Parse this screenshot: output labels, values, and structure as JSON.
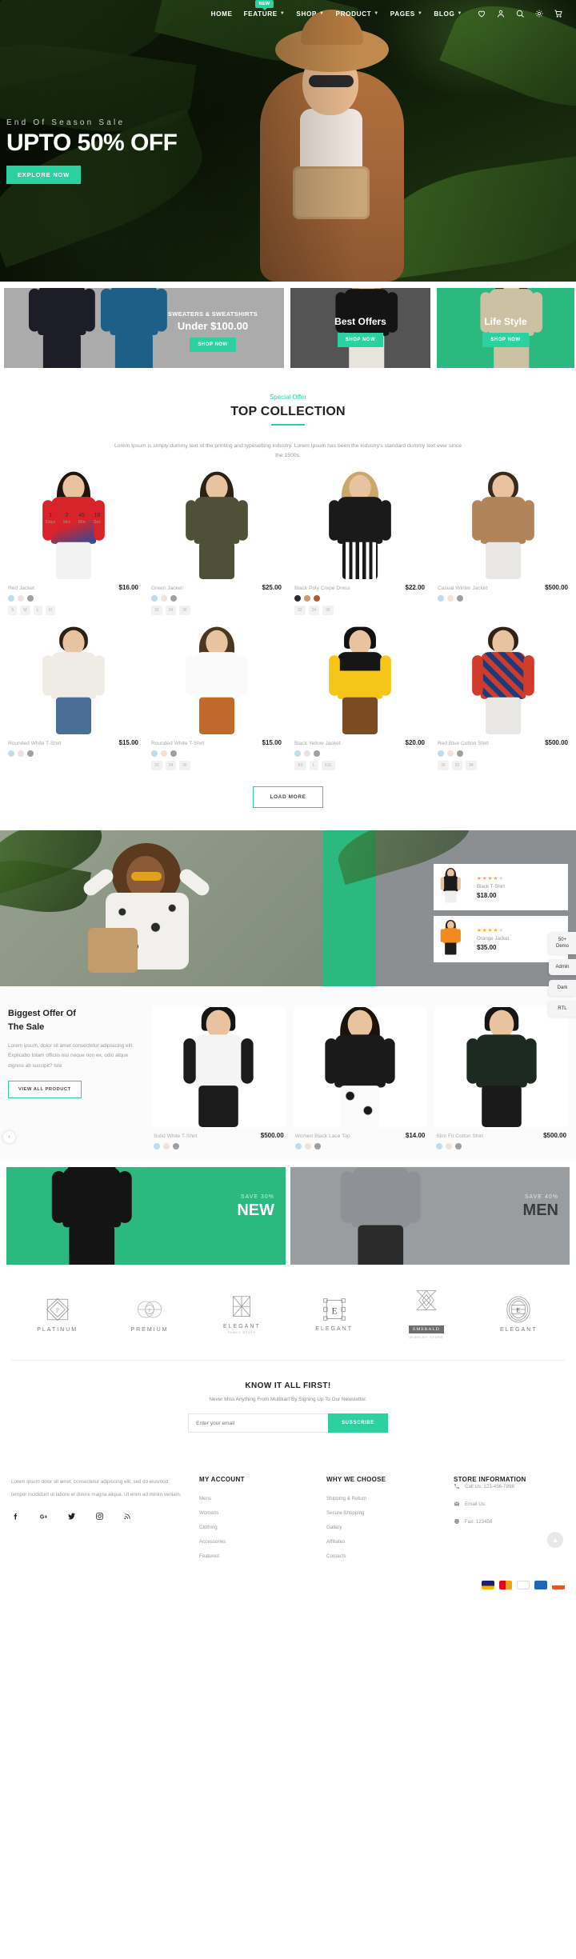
{
  "nav": {
    "items": [
      {
        "label": "HOME",
        "caret": false,
        "badge": null
      },
      {
        "label": "FEATURE",
        "caret": true,
        "badge": "NEW"
      },
      {
        "label": "SHOP",
        "caret": true,
        "badge": null
      },
      {
        "label": "PRODUCT",
        "caret": true,
        "badge": null
      },
      {
        "label": "PAGES",
        "caret": true,
        "badge": null
      },
      {
        "label": "BLOG",
        "caret": true,
        "badge": null
      }
    ],
    "icons": [
      "heart-icon",
      "user-icon",
      "search-icon",
      "gear-icon",
      "cart-icon"
    ]
  },
  "hero": {
    "kicker": "End Of Season Sale",
    "title": "UPTO 50% OFF",
    "button": "EXPLORE NOW"
  },
  "promos": [
    {
      "kicker": "SWEATERS & SWEATSHIRTS",
      "head": "Under $100.00",
      "button": "SHOP NOW"
    },
    {
      "kicker": "",
      "head": "Best Offers",
      "button": "SHOP NOW"
    },
    {
      "kicker": "",
      "head": "Life Style",
      "button": "SHOP NOW"
    }
  ],
  "top_collection": {
    "kicker": "Special Offer",
    "title": "TOP COLLECTION",
    "desc": "Lorem Ipsum is simply dummy text of the printing and typesetting industry. Lorem Ipsum has been the industry's standard dummy text ever since the 1500s.",
    "load_more": "LOAD MORE",
    "countdown": {
      "days": "1",
      "hrs": "2",
      "min": "45",
      "sec": "18",
      "days_label": "Days",
      "hrs_label": "Hrs",
      "min_label": "Min",
      "sec_label": "Sec"
    },
    "products": [
      {
        "name": "Red Jacket",
        "price": "$16.00",
        "sizes": [
          "S",
          "M",
          "L",
          "Xl"
        ],
        "colors": [
          "#bfdcef",
          "#f0e2db",
          "#a0a0a0"
        ]
      },
      {
        "name": "Green Jacket",
        "price": "$25.00",
        "sizes": [
          "32",
          "34",
          "36"
        ],
        "colors": [
          "#bfdcef",
          "#f0e2db",
          "#a0a0a0"
        ]
      },
      {
        "name": "Black Poly Crepe Dress",
        "price": "$22.00",
        "sizes": [
          "32",
          "34",
          "36"
        ],
        "colors": [
          "#2b2b2b",
          "#c89a74",
          "#b05a33"
        ]
      },
      {
        "name": "Casual Winter Jacket",
        "price": "$500.00",
        "sizes": [],
        "colors": [
          "#bfdcef",
          "#f0e2db",
          "#a0a0a0"
        ]
      },
      {
        "name": "Rounded White T-Shirt",
        "price": "$15.00",
        "sizes": [],
        "colors": [
          "#bfdcef",
          "#f0e2db",
          "#a0a0a0"
        ]
      },
      {
        "name": "Rounded White T-Shirt",
        "price": "$15.00",
        "sizes": [
          "32",
          "34",
          "36"
        ],
        "colors": [
          "#bfdcef",
          "#f0e2db",
          "#a0a0a0"
        ]
      },
      {
        "name": "Black Yellow Jacket",
        "price": "$20.00",
        "sizes": [
          "XS",
          "L",
          "XXL"
        ],
        "colors": [
          "#bfdcef",
          "#f0e2db",
          "#a0a0a0"
        ]
      },
      {
        "name": "Red Blue Cotton Shirt",
        "price": "$500.00",
        "sizes": [
          "30",
          "32",
          "34"
        ],
        "colors": [
          "#bfdcef",
          "#f0e2db",
          "#a0a0a0"
        ]
      }
    ]
  },
  "side_cards": [
    {
      "name": "Black T-Shirt",
      "price": "$18.00",
      "stars": 4,
      "stars_total": 5
    },
    {
      "name": "Orange Jacket",
      "price": "$35.00",
      "stars": 4,
      "stars_total": 5
    }
  ],
  "offer": {
    "head_line1": "Biggest Offer Of",
    "head_line2": "The Sale",
    "desc": "Lorem ipsum, dolor sit amet consectetur adipisicing elit. Explicabo totam officiis nisi neque non ex, odio atque digniss ab suscipit? Iste",
    "button": "VIEW ALL PRODUCT",
    "prev_arrow": "‹",
    "products": [
      {
        "name": "Solid White T-Shirt",
        "price": "$500.00",
        "colors": [
          "#bfdcef",
          "#f0e2db",
          "#a0a0a0"
        ]
      },
      {
        "name": "Women Black Lace Top",
        "price": "$14.00",
        "colors": [
          "#bfdcef",
          "#f0e2db",
          "#a0a0a0"
        ]
      },
      {
        "name": "Slim Fit Cotton Shirt",
        "price": "$500.00",
        "colors": [
          "#bfdcef",
          "#f0e2db",
          "#a0a0a0"
        ]
      }
    ]
  },
  "duo": [
    {
      "kicker": "SAVE 30%",
      "head": "NEW"
    },
    {
      "kicker": "SAVE 40%",
      "head": "MEN"
    }
  ],
  "brands": [
    {
      "name": "PLATINUM",
      "sub": "",
      "icon": "platinum-diamond-logo"
    },
    {
      "name": "PREMIUM",
      "sub": "",
      "icon": "premium-circles-logo"
    },
    {
      "name": "ELEGANT",
      "sub": "FANCY STUFF",
      "icon": "elegant-star-logo"
    },
    {
      "name": "ELEGANT",
      "sub": "",
      "icon": "elegant-frame-logo"
    },
    {
      "name": "EMERALD",
      "sub": "JEWELRY STORE",
      "icon": "emerald-hourglass-logo"
    },
    {
      "name": "ELEGANT",
      "sub": "",
      "icon": "elegant-oval-logo"
    }
  ],
  "newsletter": {
    "title": "KNOW IT ALL FIRST!",
    "subtitle": "Never Miss Anything From Multikart By Signing Up To Our Newsletter.",
    "placeholder": "Enter your email",
    "value": "",
    "button": "SUBSCRIBE"
  },
  "footer": {
    "about": "Lorem ipsum dolor sit amet, consectetur adipiscing elit, sed do eiusmod tempor incididunt ut labore et dolore magna aliqua. Ut enim ad minim veniam,",
    "social": [
      "facebook-icon",
      "google-plus-icon",
      "twitter-icon",
      "instagram-icon",
      "rss-icon"
    ],
    "columns": [
      {
        "title": "MY ACCOUNT",
        "items": [
          "Mens",
          "Womens",
          "Clothing",
          "Accessories",
          "Featured"
        ]
      },
      {
        "title": "WHY WE CHOOSE",
        "items": [
          "Shipping & Return",
          "Secure Shopping",
          "Gallary",
          "Affiliates",
          "Contacts"
        ]
      }
    ],
    "store": {
      "title": "STORE INFORMATION",
      "items": [
        {
          "icon": "phone-icon",
          "text": "Call Us: 123-456-7898"
        },
        {
          "icon": "mail-icon",
          "text": "Email Us:"
        },
        {
          "icon": "fax-icon",
          "text": "Fax: 123456"
        }
      ]
    },
    "payments": [
      "visa",
      "mastercard",
      "paypal",
      "discover",
      "amex"
    ],
    "to_top": "▲"
  },
  "demo_tabs": [
    {
      "label": "50+ Demo"
    },
    {
      "label": "Admin"
    },
    {
      "label": "Dark"
    },
    {
      "label": "RTL"
    }
  ],
  "colors": {
    "accent": "#2bd1a0",
    "accent_dark": "#2bb97f",
    "star": "#ffa41c"
  }
}
